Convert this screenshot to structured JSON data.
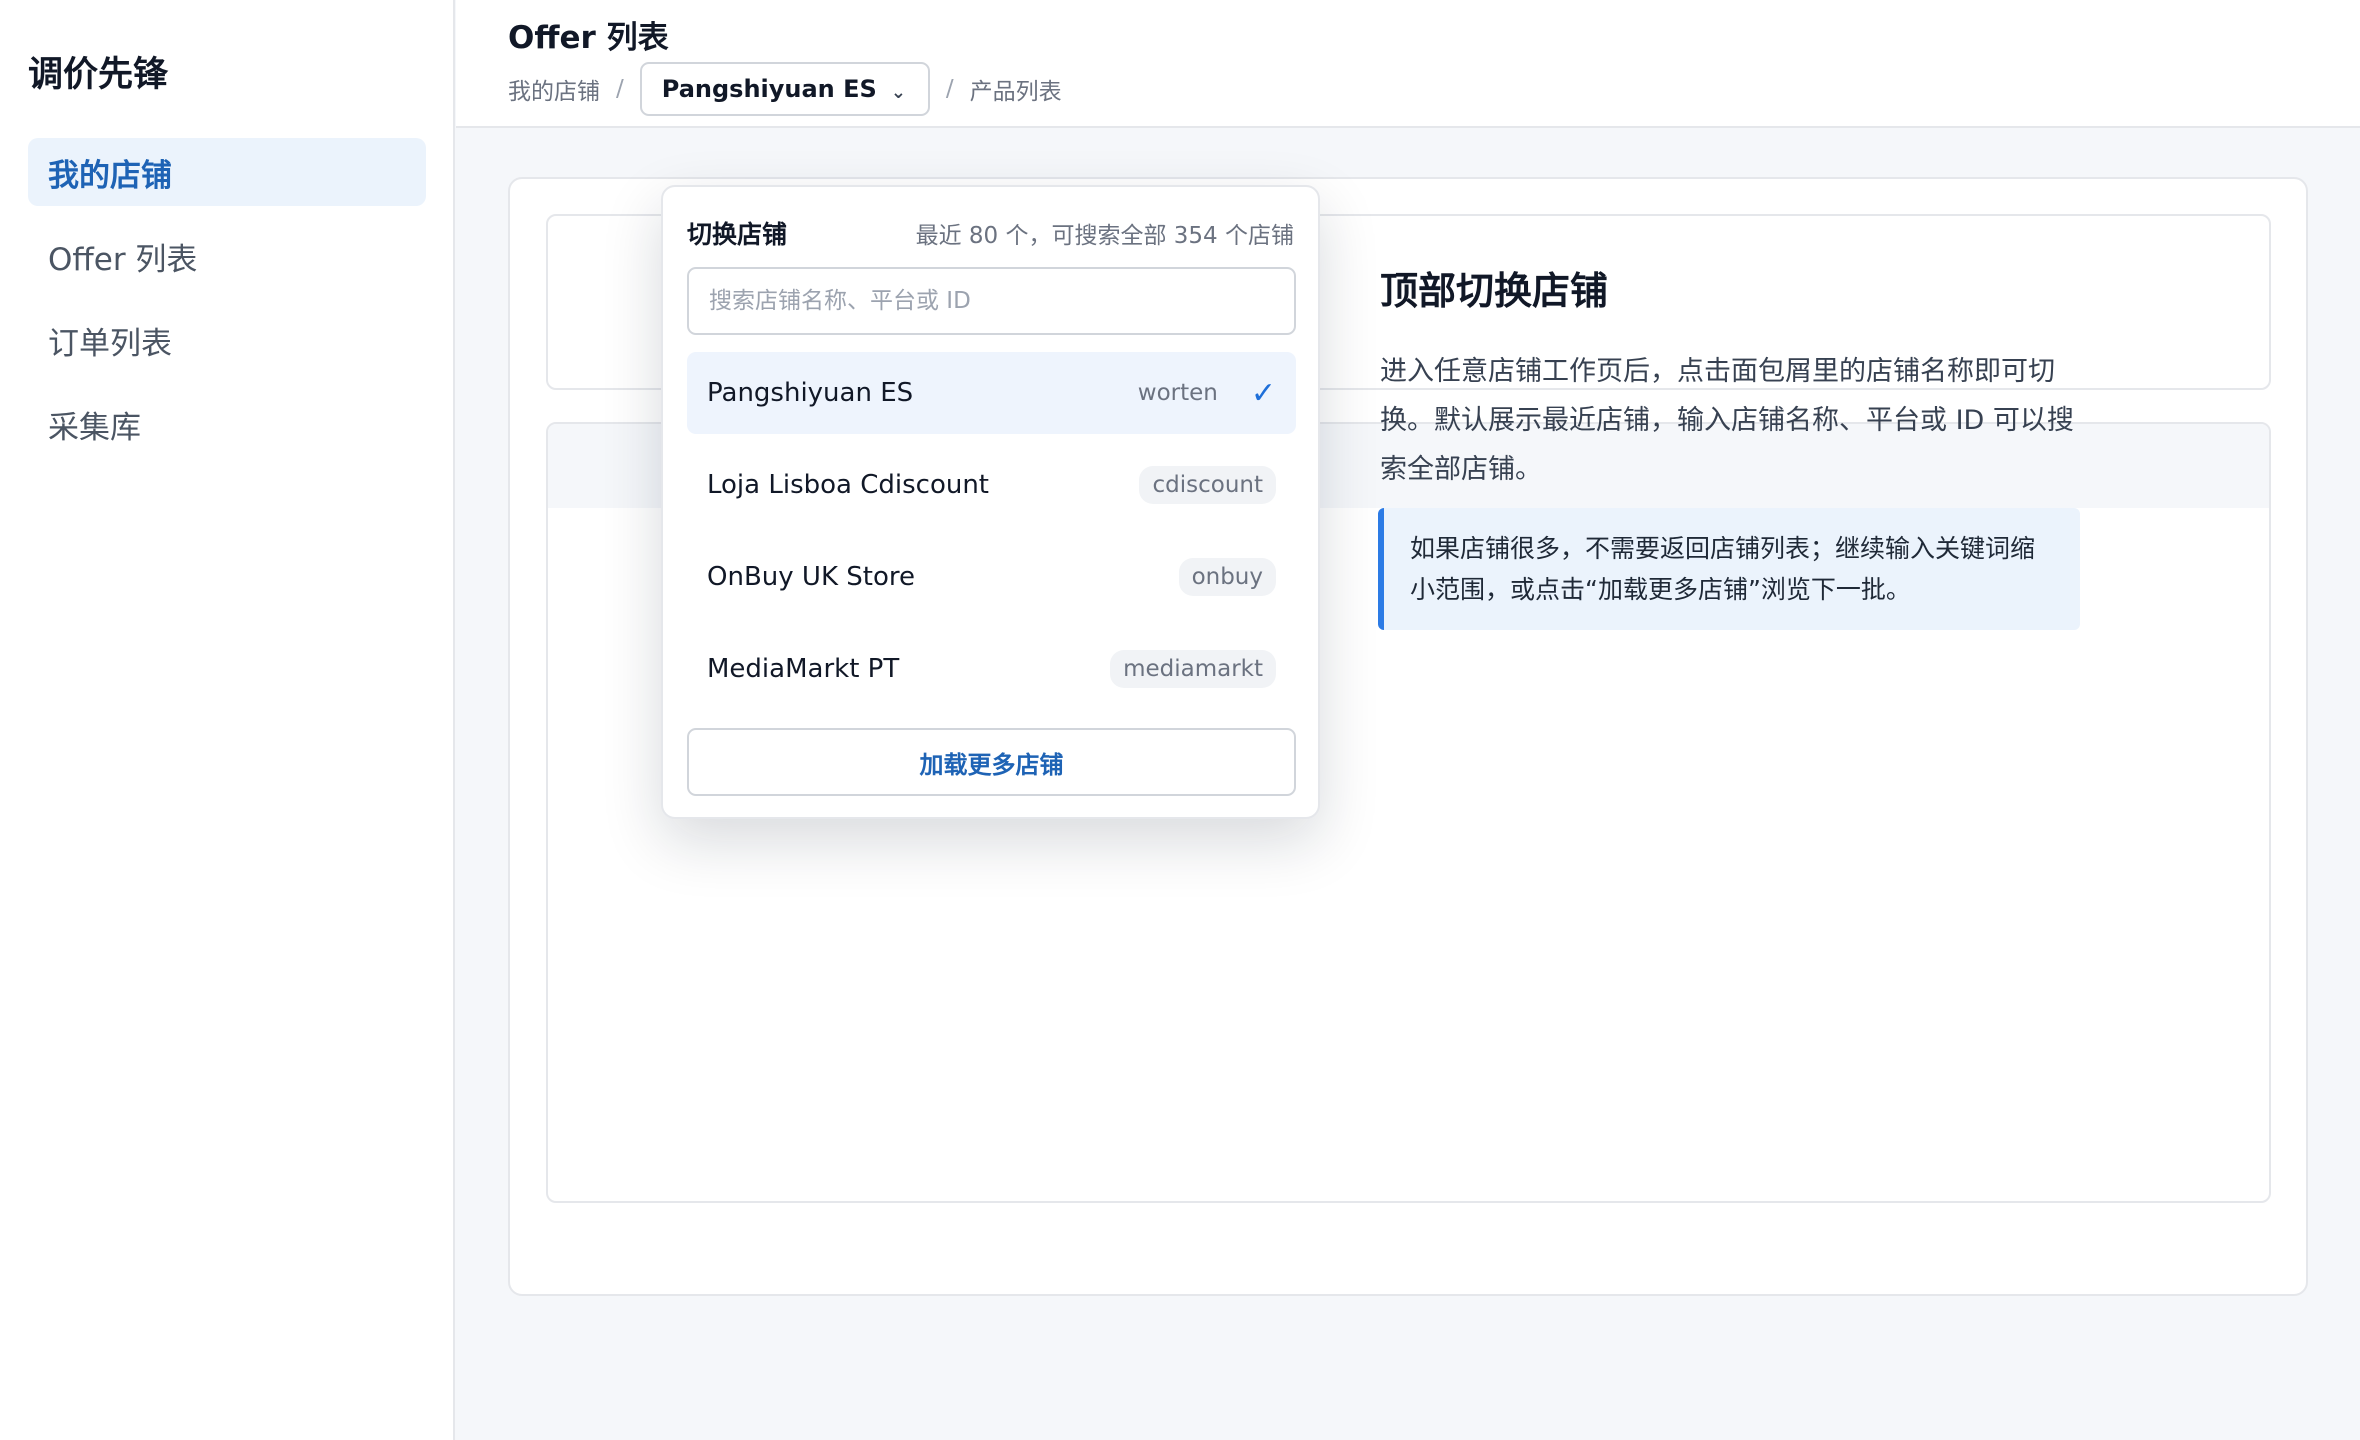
{
  "sidebar": {
    "brand": "调价先锋",
    "items": [
      {
        "label": "我的店铺",
        "active": true
      },
      {
        "label": "Offer 列表",
        "active": false
      },
      {
        "label": "订单列表",
        "active": false
      },
      {
        "label": "采集库",
        "active": false
      }
    ]
  },
  "header": {
    "title": "Offer 列表",
    "breadcrumb": {
      "root": "我的店铺",
      "separator": "/",
      "current_store": "Pangshiyuan ES",
      "page": "产品列表"
    }
  },
  "store_dropdown": {
    "title": "切换店铺",
    "meta": "最近 80 个，可搜索全部 354 个店铺",
    "search_placeholder": "搜索店铺名称、平台或 ID",
    "search_value": "",
    "stores": [
      {
        "name": "Pangshiyuan ES",
        "platform": "worten",
        "selected": true
      },
      {
        "name": "Loja Lisboa Cdiscount",
        "platform": "cdiscount",
        "selected": false
      },
      {
        "name": "OnBuy UK Store",
        "platform": "onbuy",
        "selected": false
      },
      {
        "name": "MediaMarkt PT",
        "platform": "mediamarkt",
        "selected": false
      }
    ],
    "load_more_label": "加载更多店铺"
  },
  "guide": {
    "title": "顶部切换店铺",
    "description": "进入任意店铺工作页后，点击面包屑里的店铺名称即可切换。默认展示最近店铺，输入店铺名称、平台或 ID 可以搜索全部店铺。",
    "tip": "如果店铺很多，不需要返回店铺列表；继续输入关键词缩小范围，或点击“加载更多店铺”浏览下一批。"
  },
  "colors": {
    "accent": "#1e63b5",
    "selected_bg": "#eef4fd",
    "tip_border": "#2c7be5"
  }
}
